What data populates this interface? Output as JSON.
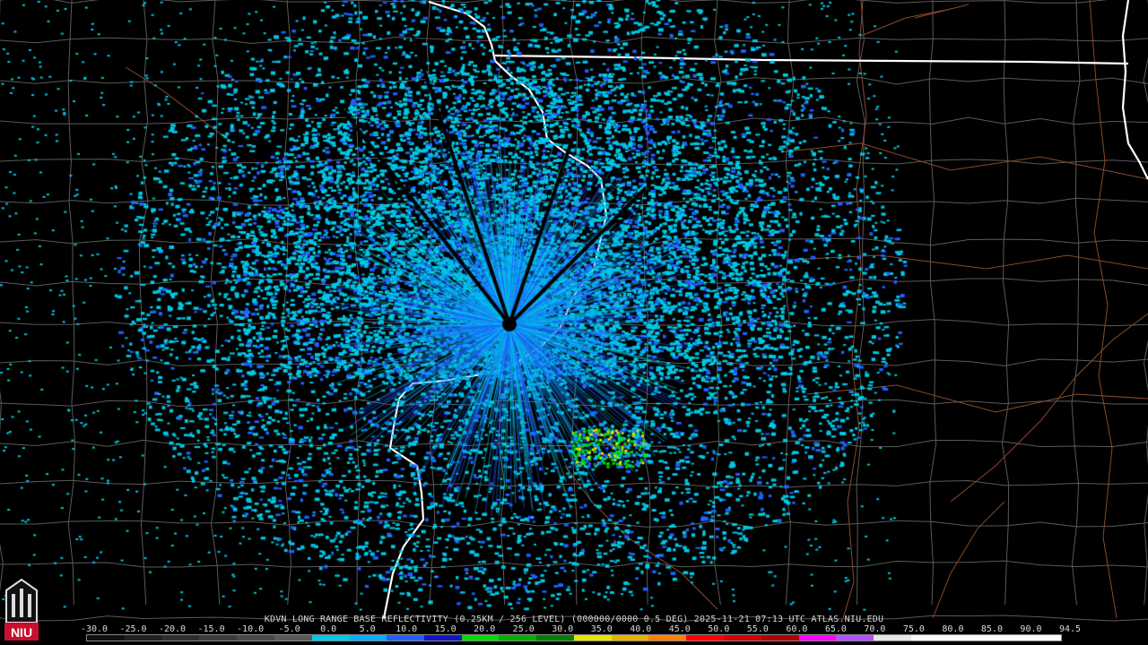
{
  "caption": "KDVN LONG RANGE BASE REFLECTIVITY (0.25KM / 256 LEVEL) (000000/0000 0.5 DEG) 2025-11-21 07:13 UTC  ATLAS.NIU.EDU",
  "logo_text": "NIU",
  "scale": {
    "labels": [
      "-30.0",
      "-25.0",
      "-20.0",
      "-15.0",
      "-10.0",
      "-5.0",
      "0.0",
      "5.0",
      "10.0",
      "15.0",
      "20.0",
      "25.0",
      "30.0",
      "35.0",
      "40.0",
      "45.0",
      "50.0",
      "55.0",
      "60.0",
      "65.0",
      "70.0",
      "75.0",
      "80.0",
      "85.0",
      "90.0",
      "94.5"
    ],
    "colors": [
      "#101010",
      "#202020",
      "#2e2e2e",
      "#3c3c3c",
      "#4a4a4a",
      "#5a5a5a",
      "#00c8e6",
      "#00b0ff",
      "#2060ff",
      "#1414c8",
      "#00dc00",
      "#00b000",
      "#008000",
      "#e6e600",
      "#e6b400",
      "#ff8000",
      "#ff0000",
      "#d40000",
      "#b00000",
      "#ff00ff",
      "#b450ff",
      "#e6e6e6",
      "#ffffff",
      "#ffffff",
      "#ffffff",
      "#ffffff"
    ]
  },
  "colors": {
    "background": "#000000",
    "county_lines": "#5a5a5a",
    "state_lines": "#ffffff",
    "highways": "#8b4a2a",
    "echo_light": "#00c8e6",
    "echo_mid": "#2060ff",
    "echo_strong": "#00dc00"
  }
}
